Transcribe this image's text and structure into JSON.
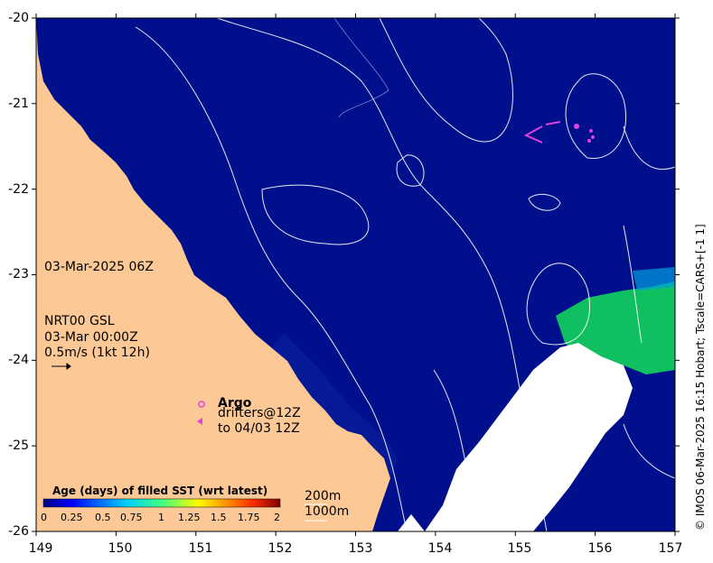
{
  "axes": {
    "x_ticks": [
      "149",
      "150",
      "151",
      "152",
      "153",
      "154",
      "155",
      "156",
      "157"
    ],
    "y_ticks": [
      "-20",
      "-21",
      "-22",
      "-23",
      "-24",
      "-25",
      "-26"
    ],
    "xlim": [
      149,
      157
    ],
    "ylim": [
      -26,
      -20
    ]
  },
  "labels": {
    "date": "03-Mar-2025 06Z",
    "nrt_line1": "NRT00 GSL",
    "nrt_line2": "03-Mar 00:00Z",
    "nrt_line3": "0.5m/s (1kt 12h)",
    "argo": "Argo",
    "drifters1": "drifters@12Z",
    "drifters2": "to 04/03 12Z",
    "depth200": "200m",
    "depth1000": "1000m",
    "credit": "© IMOS 06-Mar-2025 16:15 Hobart; Tscale=CARS+[-1 1]"
  },
  "colorbar": {
    "title": "Age (days) of filled SST (wrt latest)",
    "ticks": [
      "0",
      "0.25",
      "0.5",
      "0.75",
      "1",
      "1.25",
      "1.5",
      "1.75",
      "2"
    ]
  },
  "colors": {
    "ocean": "#00108c",
    "land": "#fcc895",
    "cloud": "#ffffff",
    "age_green": "#10c060",
    "marker": "#e040e0"
  }
}
